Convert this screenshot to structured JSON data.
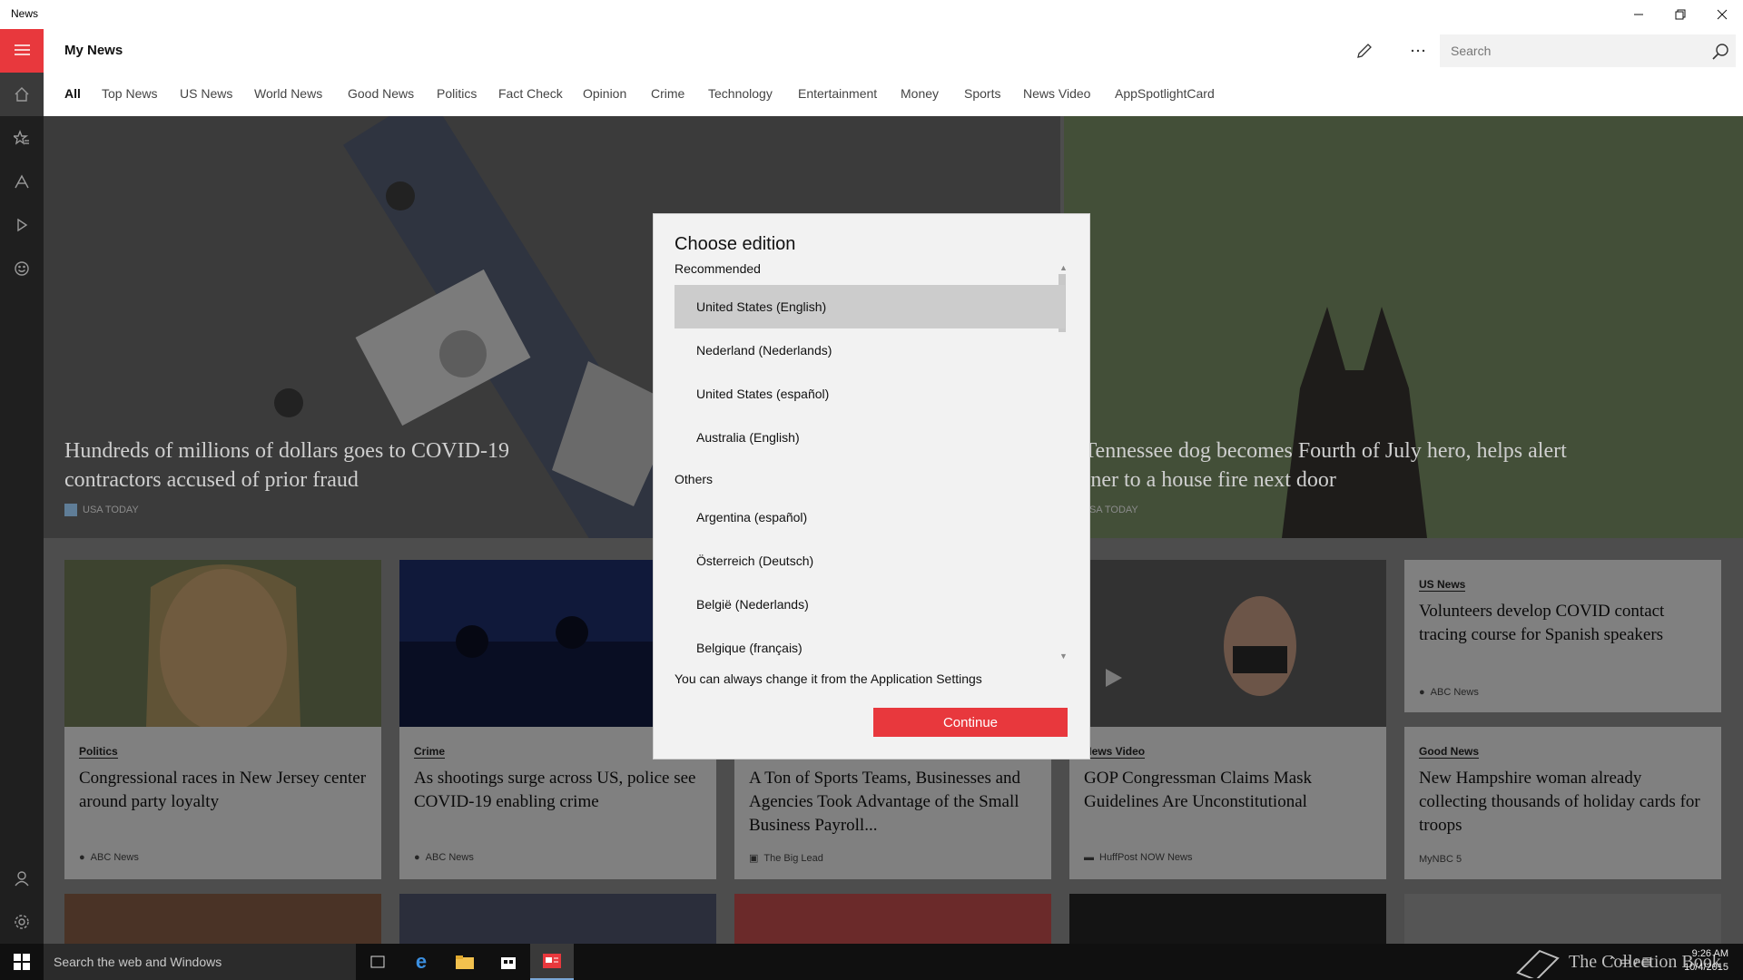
{
  "window": {
    "app_name": "News",
    "controls": {
      "minimize": "—",
      "restore": "❐",
      "close": "✕"
    }
  },
  "header": {
    "title": "My News",
    "search": {
      "placeholder": "Search",
      "value": ""
    },
    "icons": {
      "edit": "pencil-icon",
      "more": "more-icon",
      "search": "search-icon"
    }
  },
  "rail": {
    "items": [
      "home-icon",
      "interests-icon",
      "local-icon",
      "video-icon",
      "emoji-icon",
      "account-icon",
      "settings-icon"
    ]
  },
  "categories": [
    "All",
    "Top News",
    "US News",
    "World News",
    "Good News",
    "Politics",
    "Fact Check",
    "Opinion",
    "Crime",
    "Technology",
    "Entertainment",
    "Money",
    "Sports",
    "News Video",
    "AppSpotlightCard"
  ],
  "hero": {
    "left": {
      "title": "Hundreds of millions of dollars goes to COVID-19 contractors accused of prior fraud",
      "source": "USA TODAY"
    },
    "right": {
      "title": "A Tennessee dog becomes Fourth of July hero, helps alert owner to a house fire next door",
      "source": "USA TODAY"
    }
  },
  "cards": [
    {
      "category": "Politics",
      "headline": "Congressional races in New Jersey center around party loyalty",
      "source": "ABC News"
    },
    {
      "category": "Crime",
      "headline": "As shootings surge across US, police see COVID-19 enabling crime",
      "source": "ABC News"
    },
    {
      "category": "",
      "headline": "A Ton of Sports Teams, Businesses and Agencies Took Advantage of the Small Business Payroll...",
      "source": "The Big Lead"
    },
    {
      "category": "News Video",
      "headline": "GOP Congressman Claims Mask Guidelines Are Unconstitutional",
      "source": "HuffPost NOW News"
    },
    {
      "category": "Good News",
      "headline": "New Hampshire woman already collecting thousands of holiday cards for troops",
      "source": "MyNBC 5"
    }
  ],
  "side_card": {
    "category": "US News",
    "headline": "Volunteers develop COVID contact tracing course for Spanish speakers",
    "source": "ABC News"
  },
  "dialog": {
    "title": "Choose edition",
    "recommended_label": "Recommended",
    "recommended": [
      "United States (English)",
      "Nederland (Nederlands)",
      "United States (español)",
      "Australia (English)"
    ],
    "others_label": "Others",
    "others": [
      "Argentina (español)",
      "Österreich (Deutsch)",
      "België (Nederlands)",
      "Belgique (français)"
    ],
    "note": "You can always change it from the Application Settings",
    "continue_label": "Continue"
  },
  "taskbar": {
    "search_text": "Search the web and Windows",
    "time": "9:26 AM",
    "date": "10/4/2015",
    "watermark": "The Collection Book"
  },
  "colors": {
    "accent": "#e8383d",
    "rail": "#1f1f1f",
    "taskbar": "#101010"
  }
}
